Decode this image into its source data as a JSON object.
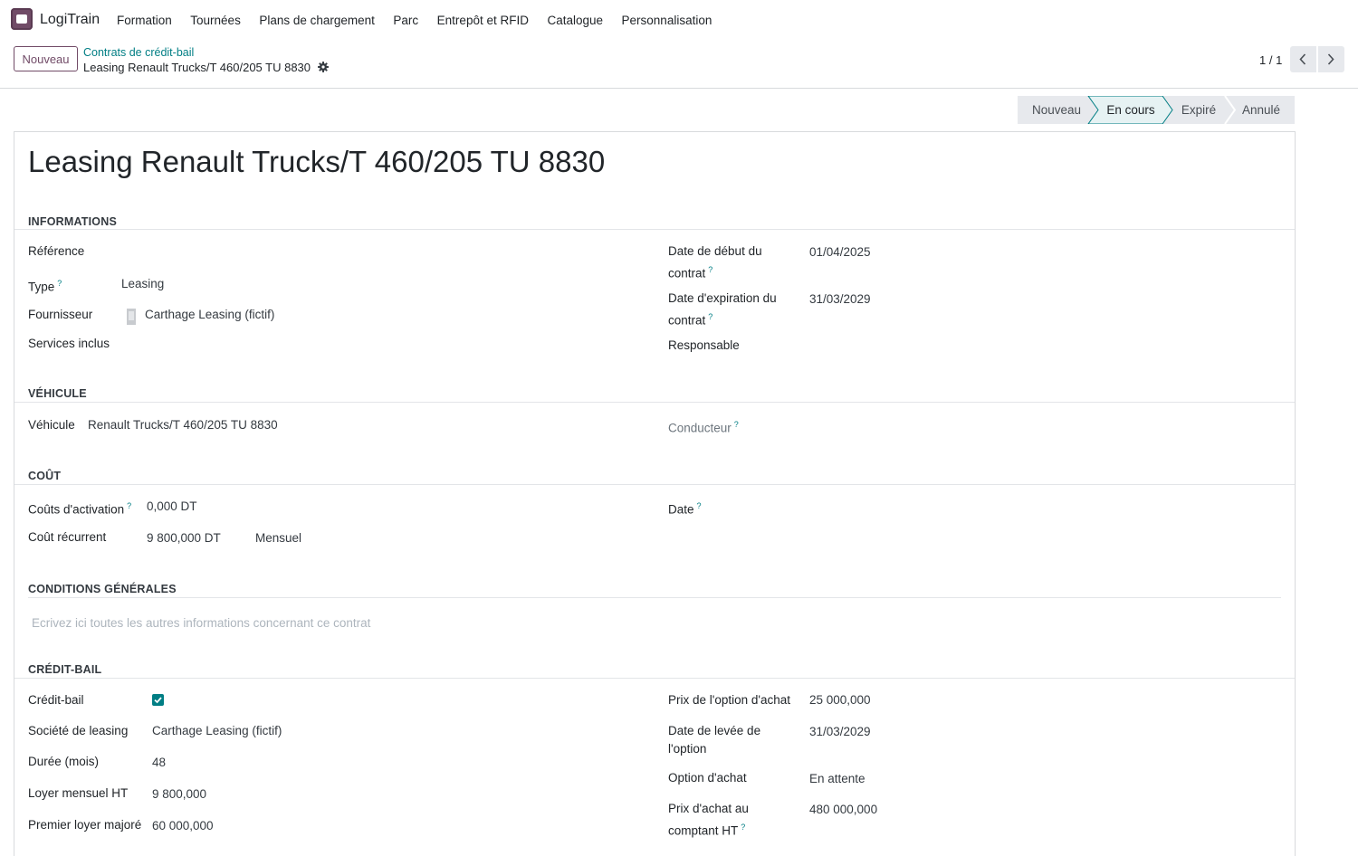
{
  "app": {
    "name": "LogiTrain"
  },
  "menu": [
    "Formation",
    "Tournées",
    "Plans de chargement",
    "Parc",
    "Entrepôt et RFID",
    "Catalogue",
    "Personnalisation"
  ],
  "control_panel": {
    "new_label": "Nouveau",
    "breadcrumb_parent": "Contrats de crédit-bail",
    "breadcrumb_current": "Leasing Renault Trucks/T 460/205 TU 8830",
    "pager": "1 / 1"
  },
  "statusbar": {
    "stages": [
      "Nouveau",
      "En cours",
      "Expiré",
      "Annulé"
    ],
    "active": "En cours"
  },
  "colors": {
    "accent": "#017e84",
    "brand": "#714b67"
  },
  "form": {
    "title": "Leasing Renault Trucks/T 460/205 TU 8830",
    "help_mark": "?",
    "sections": {
      "informations": "INFORMATIONS",
      "vehicule": "VÉHICULE",
      "cout": "COÛT",
      "conditions": "CONDITIONS GÉNÉRALES",
      "credit_bail": "CRÉDIT-BAIL"
    },
    "informations": {
      "reference_label": "Référence",
      "type_label": "Type",
      "type_value": "Leasing",
      "fournisseur_label": "Fournisseur",
      "fournisseur_value": "Carthage Leasing (fictif)",
      "services_label": "Services inclus",
      "date_debut_label_1": "Date de début du",
      "date_debut_label_2": "contrat",
      "date_debut_value": "01/04/2025",
      "date_exp_label_1": "Date d'expiration du",
      "date_exp_label_2": "contrat",
      "date_exp_value": "31/03/2029",
      "responsable_label": "Responsable"
    },
    "vehicule": {
      "vehicule_label": "Véhicule",
      "vehicule_value": "Renault Trucks/T 460/205 TU 8830",
      "conducteur_label": "Conducteur"
    },
    "cout": {
      "activation_label": "Coûts d'activation",
      "activation_value": "0,000 DT",
      "recurrent_label": "Coût récurrent",
      "recurrent_value": "9 800,000 DT",
      "recurrent_period": "Mensuel",
      "date_label": "Date"
    },
    "conditions": {
      "placeholder": "Ecrivez ici toutes les autres informations concernant ce contrat"
    },
    "credit_bail": {
      "credit_bail_label": "Crédit-bail",
      "credit_bail_checked": true,
      "societe_label": "Société de leasing",
      "societe_value": "Carthage Leasing (fictif)",
      "duree_label": "Durée (mois)",
      "duree_value": "48",
      "loyer_label": "Loyer mensuel HT",
      "loyer_value": "9 800,000",
      "premier_label": "Premier loyer majoré",
      "premier_value": "60 000,000",
      "prix_option_label": "Prix de l'option d'achat",
      "prix_option_value": "25 000,000",
      "date_levee_label_1": "Date de levée de",
      "date_levee_label_2": "l'option",
      "date_levee_value": "31/03/2029",
      "option_label": "Option d'achat",
      "option_value": "En attente",
      "prix_comptant_label_1": "Prix d'achat au",
      "prix_comptant_label_2": "comptant HT",
      "prix_comptant_value": "480 000,000"
    }
  }
}
